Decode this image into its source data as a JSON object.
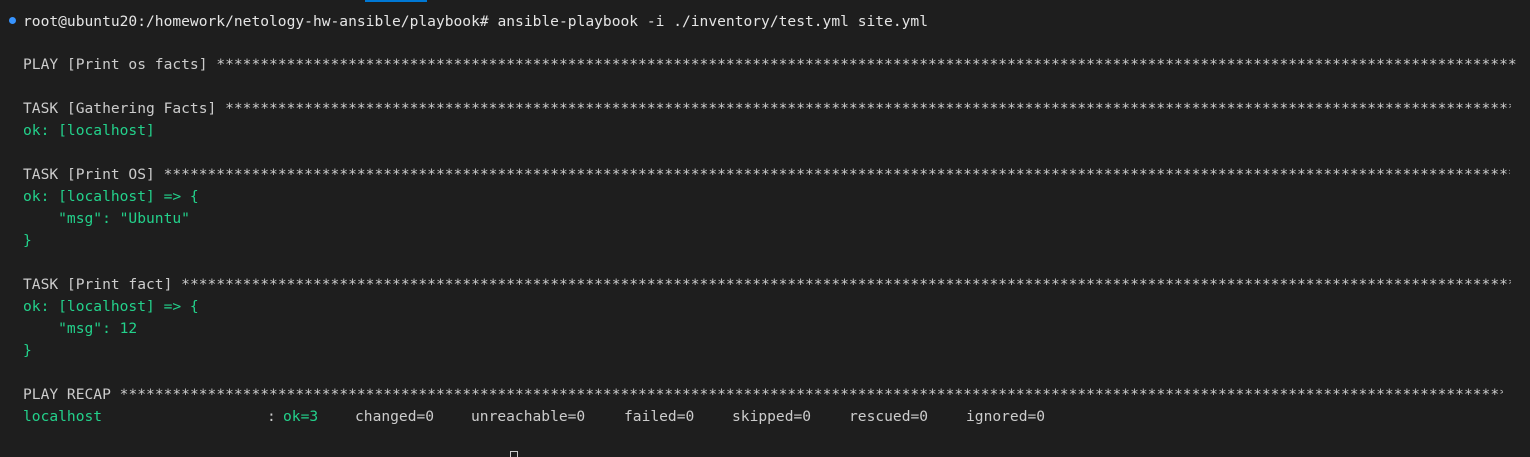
{
  "prompt": {
    "user_host_path": "root@ubuntu20:/homework/netology-hw-ansible/playbook#",
    "command": "ansible-playbook -i ./inventory/test.yml site.yml"
  },
  "play_header": {
    "label": "PLAY [Print os facts]"
  },
  "tasks": [
    {
      "header": "TASK [Gathering Facts]",
      "result": "ok: [localhost]"
    },
    {
      "header": "TASK [Print OS]",
      "result": "ok: [localhost] => {",
      "msg": "    \"msg\": \"Ubuntu\"",
      "close": "}"
    },
    {
      "header": "TASK [Print fact]",
      "result": "ok: [localhost] => {",
      "msg": "    \"msg\": 12",
      "close": "}"
    }
  ],
  "recap": {
    "header": "PLAY RECAP",
    "host": "localhost",
    "colon": ":",
    "ok": "ok=3",
    "changed": "changed=0",
    "unreachable": "unreachable=0",
    "failed": "failed=0",
    "skipped": "skipped=0",
    "rescued": "rescued=0",
    "ignored": "ignored=0"
  },
  "stars": "*******************************************************************************************************************************************************************",
  "colors": {
    "background": "#1e1e1e",
    "text": "#cccccc",
    "ok_green": "#23d18b",
    "prompt_dot": "#3794ff"
  }
}
